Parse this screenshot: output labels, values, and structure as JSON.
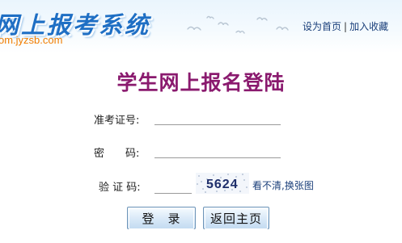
{
  "header": {
    "logo_title": "网上报考系统",
    "logo_url": "om.jyzsb.com",
    "links": {
      "set_home": "设为首页",
      "separator": "|",
      "add_favorite": "加入收藏"
    }
  },
  "form": {
    "title": "学生网上报名登陆",
    "exam_number": {
      "label": "准考证号:",
      "value": ""
    },
    "password": {
      "label": "密　　码:",
      "value": ""
    },
    "captcha": {
      "label": "验 证 码:",
      "value": "",
      "image_code": "5624",
      "refresh_link": "看不清,换张图"
    },
    "buttons": {
      "login": "登　录",
      "back_home": "返回主页"
    }
  },
  "colors": {
    "title": "#8a1a6e",
    "logo": "#1f6fc4",
    "url": "#f07d00",
    "link": "#1a3f7a"
  }
}
